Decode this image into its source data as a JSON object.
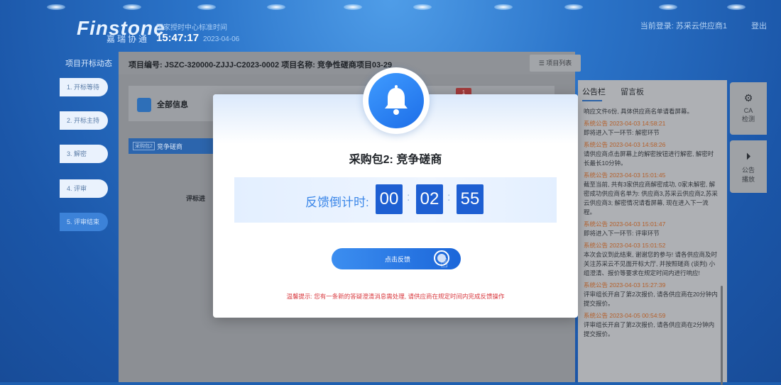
{
  "header": {
    "logo_text": "Finstone",
    "logo_sub": "嘉瑞协通",
    "center_name": "国家授时中心标准时间",
    "clock_time": "15:47:17",
    "clock_date": "2023-04-06",
    "login_text": "当前登录: 苏采云供应商1",
    "logout_label": "登出"
  },
  "sidebar": {
    "title": "项目开标动态",
    "steps": [
      {
        "label": "1. 开标等待",
        "active": false
      },
      {
        "label": "2. 开标主持",
        "active": false
      },
      {
        "label": "3. 解密",
        "active": false
      },
      {
        "label": "4. 评审",
        "active": false
      },
      {
        "label": "5. 评审结束",
        "active": true
      }
    ]
  },
  "main": {
    "project_title": "项目编号: JSZC-320000-ZJJJ-C2023-0002 项目名称: 竞争性磋商项目03-29",
    "project_list_label": "☰ 项目列表",
    "all_info_label": "全部信息",
    "badge_count": "1",
    "package_tag": "采购包2",
    "package_name": "竞争磋商",
    "eval_stage_label": "评标进"
  },
  "notice_board": {
    "tab_notice": "公告栏",
    "tab_message": "留言板",
    "items": [
      {
        "head": "",
        "text": "响应文件6份, 具体供应商名单请看屏幕。"
      },
      {
        "head": "系统公告 2023-04-03 14:58:21",
        "text": "即将进入下一环节: 解密环节"
      },
      {
        "head": "系统公告 2023-04-03 14:58:26",
        "text": "请供应商点击屏幕上的解密按钮进行解密, 解密时长最长10分钟。"
      },
      {
        "head": "系统公告 2023-04-03 15:01:45",
        "text": "截至当前, 共有3家供应商解密成功, 0家未解密, 解密成功供应商名单为: 供应商3,苏采云供应商2,苏采云供应商3; 解密情况请看屏幕, 现在进入下一流程。"
      },
      {
        "head": "系统公告 2023-04-03 15:01:47",
        "text": "即将进入下一环节: 评审环节"
      },
      {
        "head": "系统公告 2023-04-03 15:01:52",
        "text": "本次会议到此结束, 谢谢您的参与! 请各供应商及时关注苏采云不见面开标大厅, 并按照磋商 (谈判) 小组澄清、报价等要求在规定时间内进行响应!"
      },
      {
        "head": "系统公告 2023-04-03 15:27:39",
        "text": "评审组长开启了第2次报价, 请各供应商在20分钟内提交报价。"
      },
      {
        "head": "系统公告 2023-04-05 00:54:59",
        "text": "评审组长开启了第2次报价, 请各供应商在2分钟内提交报价。"
      }
    ]
  },
  "right_buttons": {
    "ca_label_1": "CA",
    "ca_label_2": "检测",
    "play_label_1": "公告",
    "play_label_2": "播放"
  },
  "dialog": {
    "title": "采购包2: 竞争磋商",
    "countdown_label": "反馈倒计时:",
    "hours": "00",
    "minutes": "02",
    "seconds": "55",
    "separator": ":",
    "button_label": "点击反馈",
    "tip": "温馨提示: 您有一条新的答疑澄清消息需处理, 请供应商在规定时间内完成反馈操作"
  }
}
